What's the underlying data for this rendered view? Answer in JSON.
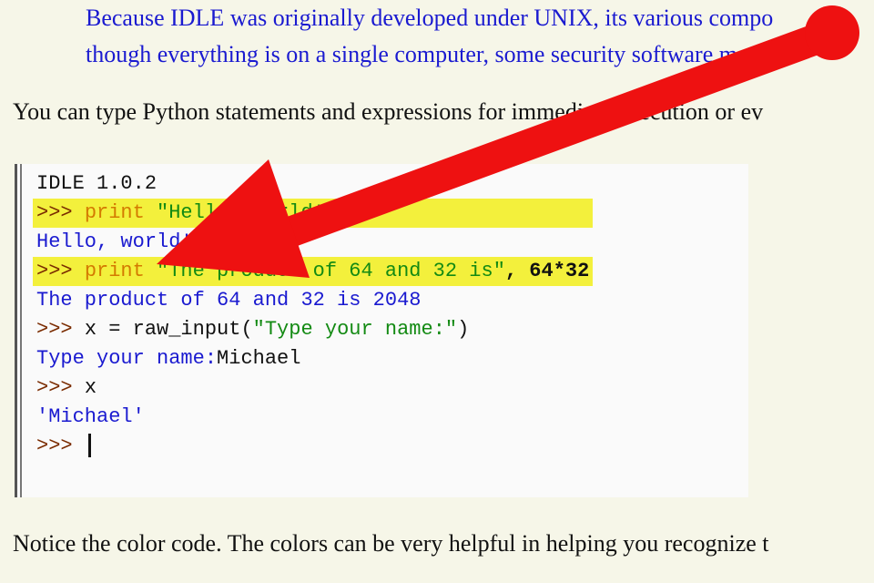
{
  "quote": {
    "line1": "Because IDLE was originally developed under UNIX, its various compo",
    "line2": "though everything is on a single computer, some security software ma"
  },
  "intro_text": "You can type Python statements and expressions for immediate execution or ev",
  "shell": {
    "lines": [
      {
        "parts": [
          {
            "t": "IDLE 1.0.2",
            "c": "plain"
          }
        ],
        "highlight": false
      },
      {
        "parts": [
          {
            "t": ">>> ",
            "c": "prompt"
          },
          {
            "t": "print ",
            "c": "kw"
          },
          {
            "t": "\"Hello, world!\"",
            "c": "str"
          }
        ],
        "highlight": true
      },
      {
        "parts": [
          {
            "t": "Hello, world!",
            "c": "out"
          }
        ],
        "highlight": false
      },
      {
        "parts": [
          {
            "t": ">>> ",
            "c": "prompt"
          },
          {
            "t": "print ",
            "c": "kw"
          },
          {
            "t": "\"The product of 64 and 32 is\"",
            "c": "str"
          },
          {
            "t": ", 64*32",
            "c": "plain bold"
          }
        ],
        "highlight": true
      },
      {
        "parts": [
          {
            "t": "The product of 64 and 32 is 2048",
            "c": "out"
          }
        ],
        "highlight": false
      },
      {
        "parts": [
          {
            "t": ">>> ",
            "c": "prompt"
          },
          {
            "t": "x = raw_input(",
            "c": "plain"
          },
          {
            "t": "\"Type your name:\"",
            "c": "str"
          },
          {
            "t": ")",
            "c": "plain"
          }
        ],
        "highlight": false
      },
      {
        "parts": [
          {
            "t": "Type your name:",
            "c": "out"
          },
          {
            "t": "Michael",
            "c": "plain"
          }
        ],
        "highlight": false
      },
      {
        "parts": [
          {
            "t": ">>> ",
            "c": "prompt"
          },
          {
            "t": "x",
            "c": "plain"
          }
        ],
        "highlight": false
      },
      {
        "parts": [
          {
            "t": "'Michael'",
            "c": "out"
          }
        ],
        "highlight": false
      },
      {
        "parts": [
          {
            "t": ">>> ",
            "c": "prompt"
          }
        ],
        "highlight": false,
        "cursor": true
      }
    ]
  },
  "footer_text": "Notice the color code. The colors can be very helpful in helping you recognize t",
  "colors": {
    "arrow": "#ee1111",
    "highlight": "#f3f03c",
    "output": "#1a1ad0",
    "string": "#138a13",
    "keyword": "#d47a00"
  }
}
